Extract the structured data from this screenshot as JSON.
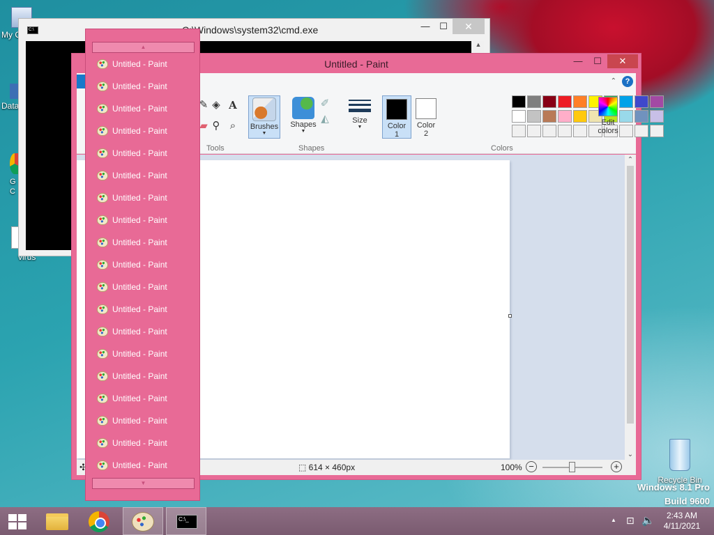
{
  "desktop": {
    "icons": [
      {
        "name": "my-computer",
        "label": "My C"
      },
      {
        "name": "data",
        "label": "Data"
      },
      {
        "name": "google-chrome",
        "label": "G C"
      },
      {
        "name": "virus",
        "label": "virus"
      },
      {
        "name": "recycle-bin",
        "label": "Recycle Bin"
      }
    ],
    "watermark_line1": "Windows 8.1 Pro",
    "watermark_line2": "Build 9600"
  },
  "cmd_window": {
    "title": "C:\\Windows\\system32\\cmd.exe",
    "minimize": "—",
    "maximize": "☐",
    "close": "✕"
  },
  "paint_window": {
    "title": "Untitled - Paint",
    "minimize": "—",
    "maximize": "☐",
    "close": "✕",
    "help": "?",
    "ribbon": {
      "tools_label": "Tools",
      "brushes_label": "Brushes",
      "shapes_label": "Shapes",
      "shapes_group_label": "Shapes",
      "size_label": "Size",
      "color1_label": "Color 1",
      "color2_label": "Color 2",
      "colors_group_label": "Colors",
      "edit_colors_label": "Edit colors",
      "color1": "#000000",
      "color2": "#ffffff",
      "palette_row1": [
        "#000000",
        "#7f7f7f",
        "#880015",
        "#ed1c24",
        "#ff7f27",
        "#fff200",
        "#22b14c",
        "#00a2e8",
        "#3f48cc",
        "#a349a4"
      ],
      "palette_row2": [
        "#ffffff",
        "#c3c3c3",
        "#b97a57",
        "#ffaec9",
        "#ffc90e",
        "#efe4b0",
        "#b5e61d",
        "#99d9ea",
        "#7092be",
        "#c8bfe7"
      ],
      "palette_row3": [
        "#f0f0f0",
        "#f0f0f0",
        "#f0f0f0",
        "#f0f0f0",
        "#f0f0f0",
        "#f0f0f0",
        "#f0f0f0",
        "#f0f0f0",
        "#f0f0f0",
        "#f0f0f0"
      ]
    },
    "status": {
      "dimensions": "614 × 460px",
      "zoom": "100%",
      "zoom_out": "−",
      "zoom_in": "+"
    }
  },
  "jumplist": {
    "scroll_up": "▲",
    "scroll_down": "▼",
    "items": [
      "Untitled - Paint",
      "Untitled - Paint",
      "Untitled - Paint",
      "Untitled - Paint",
      "Untitled - Paint",
      "Untitled - Paint",
      "Untitled - Paint",
      "Untitled - Paint",
      "Untitled - Paint",
      "Untitled - Paint",
      "Untitled - Paint",
      "Untitled - Paint",
      "Untitled - Paint",
      "Untitled - Paint",
      "Untitled - Paint",
      "Untitled - Paint",
      "Untitled - Paint",
      "Untitled - Paint",
      "Untitled - Paint"
    ]
  },
  "taskbar": {
    "time": "2:43 AM",
    "date": "4/11/2021",
    "tray_arrow": "▲"
  }
}
